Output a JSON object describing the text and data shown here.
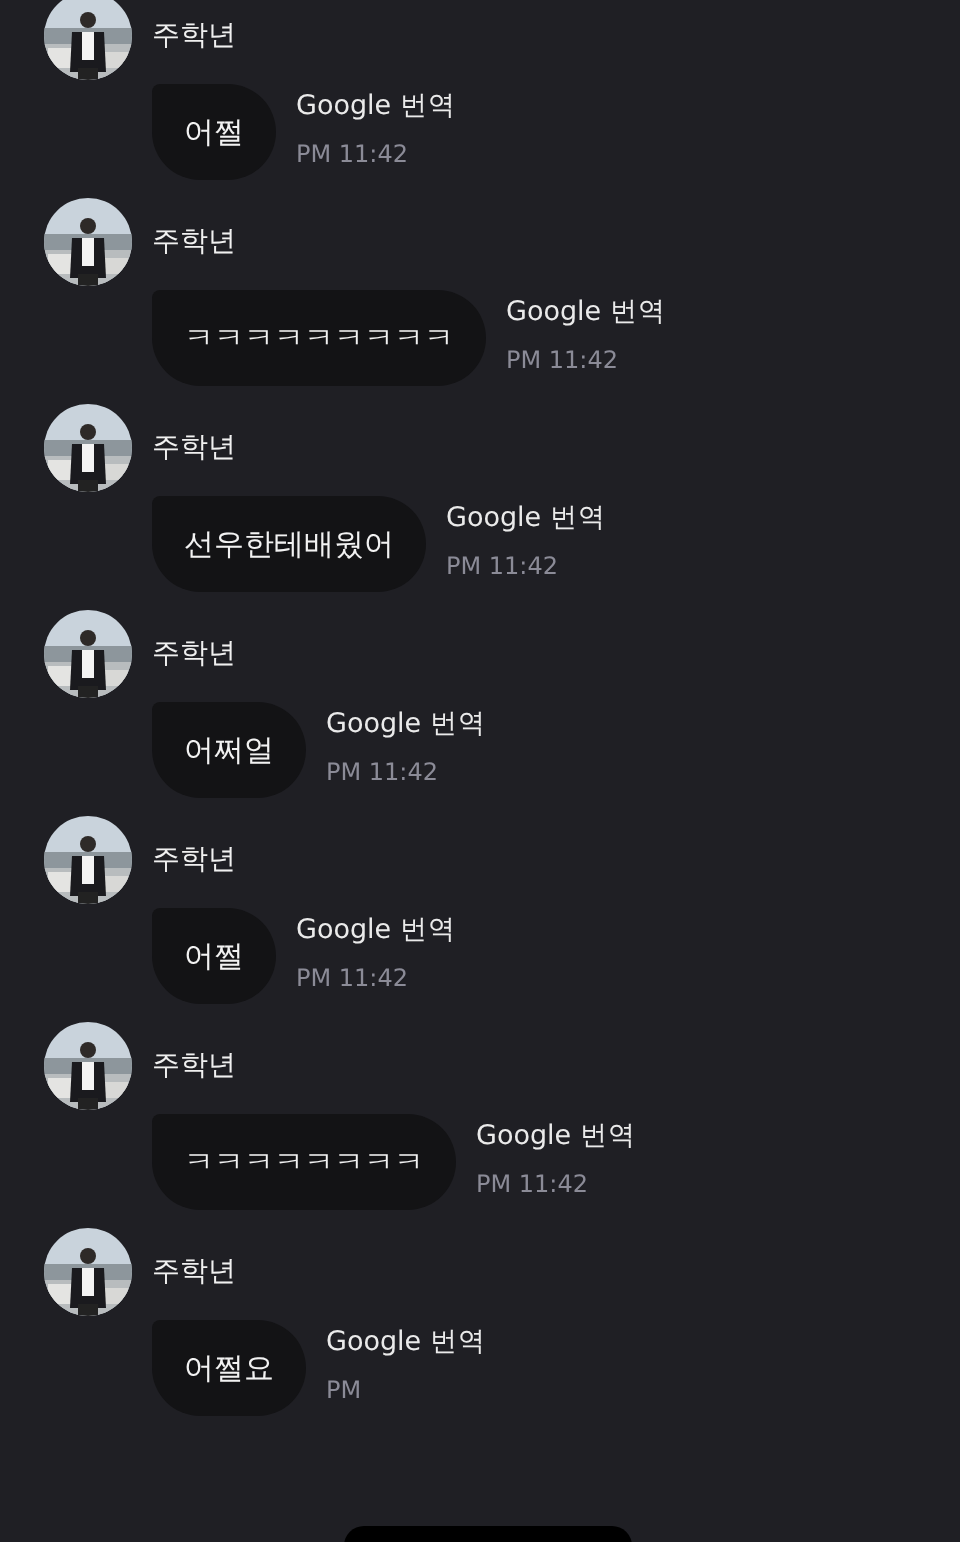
{
  "messages": [
    {
      "sender": "주학년",
      "text": "어쩔",
      "label": "Google 번역",
      "time": "PM 11:42"
    },
    {
      "sender": "주학년",
      "text": "ㅋㅋㅋㅋㅋㅋㅋㅋㅋ",
      "label": "Google 번역",
      "time": "PM 11:42"
    },
    {
      "sender": "주학년",
      "text": "선우한테배웠어",
      "label": "Google 번역",
      "time": "PM 11:42"
    },
    {
      "sender": "주학년",
      "text": "어쩌얼",
      "label": "Google 번역",
      "time": "PM 11:42"
    },
    {
      "sender": "주학년",
      "text": "어쩔",
      "label": "Google 번역",
      "time": "PM 11:42"
    },
    {
      "sender": "주학년",
      "text": "ㅋㅋㅋㅋㅋㅋㅋㅋ",
      "label": "Google 번역",
      "time": "PM 11:42"
    },
    {
      "sender": "주학년",
      "text": "어쩔요",
      "label": "Google 번역",
      "time": "PM"
    }
  ]
}
